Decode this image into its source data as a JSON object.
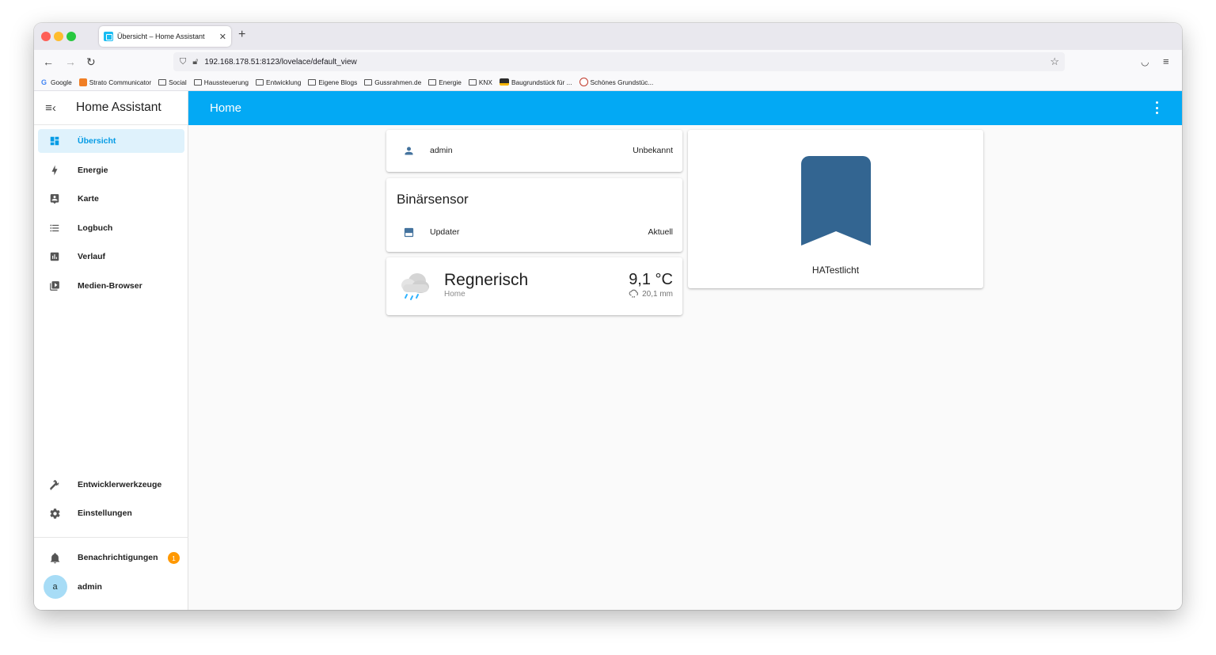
{
  "browser": {
    "tab_title": "Übersicht – Home Assistant",
    "tab_close": "✕",
    "new_tab": "+",
    "url": "192.168.178.51:8123/lovelace/default_view",
    "bookmarks": [
      {
        "label": "Google",
        "icon": "google"
      },
      {
        "label": "Strato Communicator",
        "icon": "strato"
      },
      {
        "label": "Social",
        "icon": "folder"
      },
      {
        "label": "Haussteuerung",
        "icon": "folder"
      },
      {
        "label": "Entwicklung",
        "icon": "folder"
      },
      {
        "label": "Eigene Blogs",
        "icon": "folder"
      },
      {
        "label": "Gussrahmen.de",
        "icon": "folder"
      },
      {
        "label": "Energie",
        "icon": "folder"
      },
      {
        "label": "KNX",
        "icon": "folder"
      },
      {
        "label": "Baugrundstück für ...",
        "icon": "site"
      },
      {
        "label": "Schönes Grundstüc...",
        "icon": "site-k"
      }
    ]
  },
  "sidebar": {
    "title": "Home Assistant",
    "items": [
      {
        "label": "Übersicht",
        "icon": "dashboard-icon",
        "active": true
      },
      {
        "label": "Energie",
        "icon": "lightning-icon"
      },
      {
        "label": "Karte",
        "icon": "map-account-icon"
      },
      {
        "label": "Logbuch",
        "icon": "list-icon"
      },
      {
        "label": "Verlauf",
        "icon": "chart-icon"
      },
      {
        "label": "Medien-Browser",
        "icon": "media-icon"
      }
    ],
    "bottom_items": [
      {
        "label": "Entwicklerwerkzeuge",
        "icon": "hammer-icon"
      },
      {
        "label": "Einstellungen",
        "icon": "cog-icon"
      }
    ],
    "notifications": {
      "label": "Benachrichtigungen",
      "count": "1"
    },
    "user": {
      "initial": "a",
      "name": "admin"
    }
  },
  "toolbar": {
    "title": "Home"
  },
  "cards": {
    "person": {
      "name": "admin",
      "state": "Unbekannt"
    },
    "binary_sensor": {
      "header": "Binärsensor",
      "name": "Updater",
      "state": "Aktuell"
    },
    "weather": {
      "condition": "Regnerisch",
      "location": "Home",
      "temperature": "9,1 °C",
      "precipitation": "20,1 mm"
    },
    "picture": {
      "name": "HATestlicht"
    }
  },
  "colors": {
    "primary": "#03a9f4",
    "sidebar_active_bg": "#dff2fc",
    "badge": "#ff9800",
    "entity_icon": "#44739e"
  }
}
